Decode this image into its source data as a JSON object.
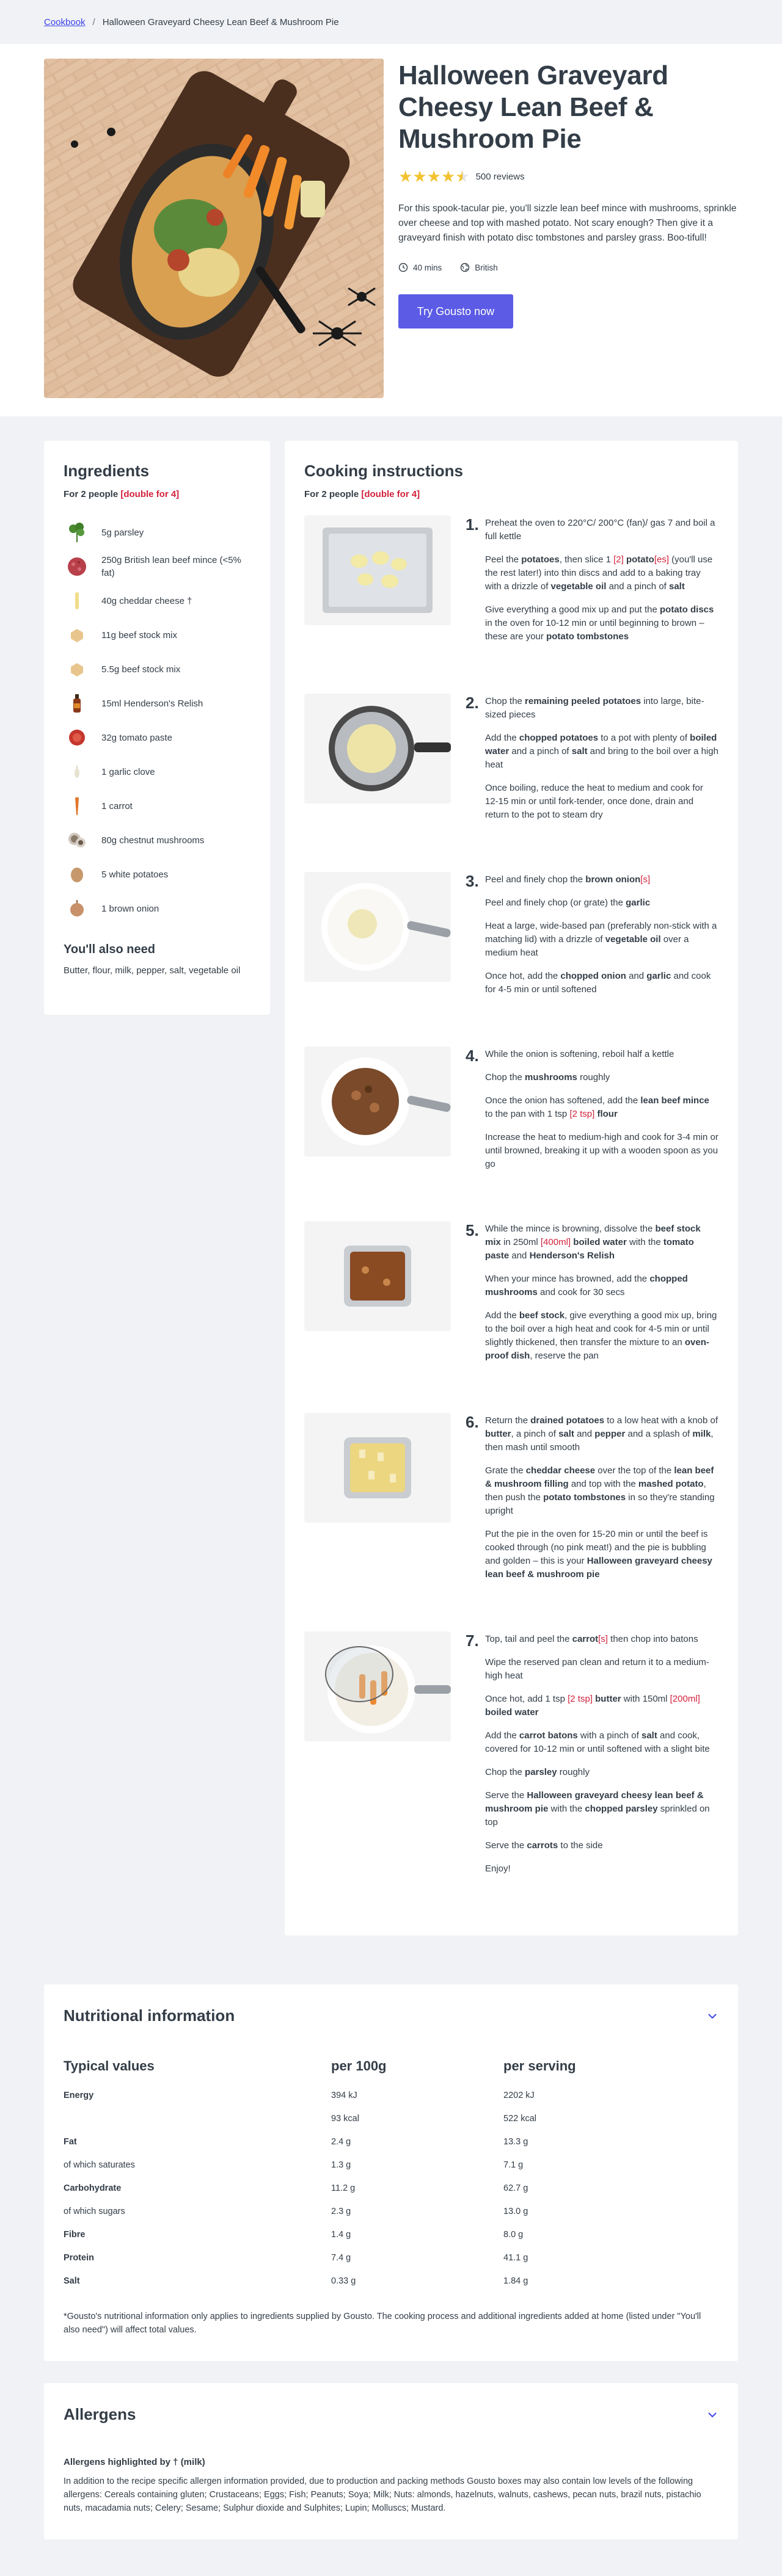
{
  "breadcrumb": {
    "root": "Cookbook",
    "separator": "/",
    "current": "Halloween Graveyard Cheesy Lean Beef & Mushroom Pie"
  },
  "recipe": {
    "title": "Halloween Graveyard Cheesy Lean Beef & Mushroom Pie",
    "rating_value": 4.5,
    "reviews": "500 reviews",
    "description": "For this spook-tacular pie, you'll sizzle lean beef mince with mushrooms, sprinkle over cheese and top with mashed potato. Not scary enough? Then give it a graveyard finish with potato disc tombstones and parsley grass. Boo-tifull!",
    "time": "40 mins",
    "cuisine": "British",
    "time_icon": "clock-icon",
    "cuisine_icon": "globe-icon",
    "cta": "Try Gousto now"
  },
  "ingredients": {
    "title": "Ingredients",
    "servings_text": "For 2 people",
    "double_text": "[double for 4]",
    "items": [
      {
        "label": "5g parsley",
        "icon": "parsley"
      },
      {
        "label": "250g British lean beef mince (<5% fat)",
        "icon": "beef-mince"
      },
      {
        "label": "40g cheddar cheese †",
        "icon": "cheddar"
      },
      {
        "label": "11g beef stock mix",
        "icon": "stock-mix"
      },
      {
        "label": "5.5g beef stock mix",
        "icon": "stock-mix"
      },
      {
        "label": "15ml Henderson's Relish",
        "icon": "relish-bottle"
      },
      {
        "label": "32g tomato paste",
        "icon": "tomato-paste"
      },
      {
        "label": "1 garlic clove",
        "icon": "garlic"
      },
      {
        "label": "1 carrot",
        "icon": "carrot"
      },
      {
        "label": "80g chestnut mushrooms",
        "icon": "mushrooms"
      },
      {
        "label": "5 white potatoes",
        "icon": "potato"
      },
      {
        "label": "1 brown onion",
        "icon": "onion"
      }
    ],
    "also_title": "You'll also need",
    "also_text": "Butter, flour, milk, pepper, salt, vegetable oil"
  },
  "instructions": {
    "title": "Cooking instructions",
    "servings_text": "For 2 people",
    "double_text": "[double for 4]",
    "steps": [
      {
        "num": "1.",
        "image": "potato-discs-on-tray",
        "paras": [
          [
            {
              "t": "Preheat the oven to 220°C/ 200°C (fan)/ gas 7 and boil a full kettle"
            }
          ],
          [
            {
              "t": "Peel the "
            },
            {
              "t": "potatoes",
              "b": true
            },
            {
              "t": ", then slice 1 "
            },
            {
              "t": "[2]",
              "h": true
            },
            {
              "t": " "
            },
            {
              "t": "potato",
              "b": true
            },
            {
              "t": "[es]",
              "h": true
            },
            {
              "t": " (you'll use the rest later!) into thin discs and add to a baking tray with a drizzle of "
            },
            {
              "t": "vegetable oil",
              "b": true
            },
            {
              "t": " and a pinch of "
            },
            {
              "t": "salt",
              "b": true
            }
          ],
          [
            {
              "t": "Give everything a good mix up and put the "
            },
            {
              "t": "potato discs",
              "b": true
            },
            {
              "t": " in the oven for 10-12 min or until beginning to brown – these are your "
            },
            {
              "t": "potato tombstones",
              "b": true
            }
          ]
        ]
      },
      {
        "num": "2.",
        "image": "potatoes-in-pan",
        "paras": [
          [
            {
              "t": "Chop the "
            },
            {
              "t": "remaining peeled potatoes",
              "b": true
            },
            {
              "t": " into large, bite-sized pieces"
            }
          ],
          [
            {
              "t": "Add the "
            },
            {
              "t": "chopped potatoes",
              "b": true
            },
            {
              "t": " to a pot with plenty of "
            },
            {
              "t": "boiled water",
              "b": true
            },
            {
              "t": " and a pinch of "
            },
            {
              "t": "salt",
              "b": true
            },
            {
              "t": " and bring to the boil over a high heat"
            }
          ],
          [
            {
              "t": "Once boiling, reduce the heat to medium and cook for 12-15 min or until fork-tender, once done, drain and return to the pot to steam dry"
            }
          ]
        ]
      },
      {
        "num": "3.",
        "image": "onion-in-pan",
        "paras": [
          [
            {
              "t": "Peel and finely chop the "
            },
            {
              "t": "brown onion",
              "b": true
            },
            {
              "t": "[s]",
              "h": true
            }
          ],
          [
            {
              "t": "Peel and finely chop (or grate) the "
            },
            {
              "t": "garlic",
              "b": true
            }
          ],
          [
            {
              "t": "Heat a large, wide-based pan (preferably non-stick with a matching lid) with a drizzle of "
            },
            {
              "t": "vegetable oil",
              "b": true
            },
            {
              "t": " over a medium heat"
            }
          ],
          [
            {
              "t": "Once hot, add the "
            },
            {
              "t": "chopped onion",
              "b": true
            },
            {
              "t": " and "
            },
            {
              "t": "garlic",
              "b": true
            },
            {
              "t": " and cook for 4-5 min or until softened"
            }
          ]
        ]
      },
      {
        "num": "4.",
        "image": "mince-in-pan",
        "paras": [
          [
            {
              "t": "While the onion is softening, reboil half a kettle"
            }
          ],
          [
            {
              "t": "Chop the "
            },
            {
              "t": "mushrooms",
              "b": true
            },
            {
              "t": " roughly"
            }
          ],
          [
            {
              "t": "Once the onion has softened, add the "
            },
            {
              "t": "lean beef mince",
              "b": true
            },
            {
              "t": " to the pan with 1 tsp "
            },
            {
              "t": "[2 tsp]",
              "h": true
            },
            {
              "t": " "
            },
            {
              "t": "flour",
              "b": true
            }
          ],
          [
            {
              "t": "Increase the heat to medium-high and cook for 3-4 min or until browned, breaking it up with a wooden spoon as you go"
            }
          ]
        ]
      },
      {
        "num": "5.",
        "image": "filling-in-dish",
        "paras": [
          [
            {
              "t": "While the mince is browning, dissolve the "
            },
            {
              "t": "beef stock mix",
              "b": true
            },
            {
              "t": " in 250ml "
            },
            {
              "t": "[400ml]",
              "h": true
            },
            {
              "t": " "
            },
            {
              "t": "boiled water",
              "b": true
            },
            {
              "t": " with the "
            },
            {
              "t": "tomato paste",
              "b": true
            },
            {
              "t": " and "
            },
            {
              "t": "Henderson's Relish",
              "b": true
            }
          ],
          [
            {
              "t": "When your mince has browned, add the "
            },
            {
              "t": "chopped mushrooms",
              "b": true
            },
            {
              "t": " and cook for 30 secs"
            }
          ],
          [
            {
              "t": "Add the "
            },
            {
              "t": "beef stock",
              "b": true
            },
            {
              "t": ", give everything a good mix up, bring to the boil over a high heat and cook for 4-5 min or until slightly thickened, then transfer the mixture to an "
            },
            {
              "t": "oven-proof dish",
              "b": true
            },
            {
              "t": ", reserve the pan"
            }
          ]
        ]
      },
      {
        "num": "6.",
        "image": "pie-in-dish",
        "paras": [
          [
            {
              "t": "Return the "
            },
            {
              "t": "drained potatoes",
              "b": true
            },
            {
              "t": " to a low heat with a knob of "
            },
            {
              "t": "butter",
              "b": true
            },
            {
              "t": ", a pinch of "
            },
            {
              "t": "salt",
              "b": true
            },
            {
              "t": " and "
            },
            {
              "t": "pepper",
              "b": true
            },
            {
              "t": " and a splash of "
            },
            {
              "t": "milk",
              "b": true
            },
            {
              "t": ", then mash until smooth"
            }
          ],
          [
            {
              "t": "Grate the "
            },
            {
              "t": "cheddar cheese",
              "b": true
            },
            {
              "t": " over the top of the "
            },
            {
              "t": "lean beef & mushroom filling",
              "b": true
            },
            {
              "t": " and top with the "
            },
            {
              "t": "mashed potato",
              "b": true
            },
            {
              "t": ", then push the "
            },
            {
              "t": "potato tombstones",
              "b": true
            },
            {
              "t": " in so they're standing upright"
            }
          ],
          [
            {
              "t": "Put the pie in the oven for 15-20 min or until the beef is cooked through (no pink meat!) and the pie is bubbling and golden – this is your "
            },
            {
              "t": "Halloween graveyard cheesy lean beef & mushroom pie",
              "b": true
            }
          ]
        ]
      },
      {
        "num": "7.",
        "image": "carrots-in-pan",
        "paras": [
          [
            {
              "t": "Top, tail and peel the "
            },
            {
              "t": "carrot",
              "b": true
            },
            {
              "t": "[s]",
              "h": true
            },
            {
              "t": " then chop into batons"
            }
          ],
          [
            {
              "t": "Wipe the reserved pan clean and return it to a medium-high heat"
            }
          ],
          [
            {
              "t": "Once hot, add 1 tsp "
            },
            {
              "t": "[2 tsp]",
              "h": true
            },
            {
              "t": " "
            },
            {
              "t": "butter",
              "b": true
            },
            {
              "t": " with 150ml "
            },
            {
              "t": "[200ml]",
              "h": true
            },
            {
              "t": " "
            },
            {
              "t": "boiled water",
              "b": true
            }
          ],
          [
            {
              "t": "Add the "
            },
            {
              "t": "carrot batons",
              "b": true
            },
            {
              "t": " with a pinch of "
            },
            {
              "t": "salt",
              "b": true
            },
            {
              "t": " and cook, covered for 10-12 min or until softened with a slight bite"
            }
          ],
          [
            {
              "t": "Chop the "
            },
            {
              "t": "parsley",
              "b": true
            },
            {
              "t": " roughly"
            }
          ],
          [
            {
              "t": "Serve the "
            },
            {
              "t": "Halloween graveyard cheesy lean beef & mushroom pie",
              "b": true
            },
            {
              "t": " with the "
            },
            {
              "t": "chopped parsley",
              "b": true
            },
            {
              "t": " sprinkled on top"
            }
          ],
          [
            {
              "t": "Serve the "
            },
            {
              "t": "carrots",
              "b": true
            },
            {
              "t": " to the side"
            }
          ],
          [
            {
              "t": "Enjoy!"
            }
          ]
        ]
      }
    ]
  },
  "nutrition": {
    "title": "Nutritional information",
    "toggle_icon": "chevron-down-icon",
    "headers": [
      "Typical values",
      "per 100g",
      "per serving"
    ],
    "rows": [
      {
        "label": "Energy",
        "per100": "394 kJ",
        "serving": "2202 kJ",
        "bold": true
      },
      {
        "label": "",
        "per100": "93 kcal",
        "serving": "522 kcal",
        "bold": false
      },
      {
        "label": "Fat",
        "per100": "2.4 g",
        "serving": "13.3 g",
        "bold": true
      },
      {
        "label": "of which saturates",
        "per100": "1.3 g",
        "serving": "7.1 g",
        "bold": false
      },
      {
        "label": "Carbohydrate",
        "per100": "11.2 g",
        "serving": "62.7 g",
        "bold": true
      },
      {
        "label": "of which sugars",
        "per100": "2.3 g",
        "serving": "13.0 g",
        "bold": false
      },
      {
        "label": "Fibre",
        "per100": "1.4 g",
        "serving": "8.0 g",
        "bold": true
      },
      {
        "label": "Protein",
        "per100": "7.4 g",
        "serving": "41.1 g",
        "bold": true
      },
      {
        "label": "Salt",
        "per100": "0.33 g",
        "serving": "1.84 g",
        "bold": true
      }
    ],
    "note": "*Gousto's nutritional information only applies to ingredients supplied by Gousto. The cooking process and additional ingredients added at home (listed under \"You'll also need\") will affect total values."
  },
  "allergens": {
    "title": "Allergens",
    "toggle_icon": "chevron-down-icon",
    "subtitle": "Allergens highlighted by † (milk)",
    "text": "In addition to the recipe specific allergen information provided, due to production and packing methods Gousto boxes may also contain low levels of the following allergens: Cereals containing gluten; Crustaceans; Eggs; Fish; Peanuts; Soya; Milk; Nuts: almonds, hazelnuts, walnuts, cashews, pecan nuts, brazil nuts, pistachio nuts, macadamia nuts; Celery; Sesame; Sulphur dioxide and Sulphites; Lupin; Molluscs; Mustard."
  },
  "colors": {
    "accent": "#5b5be6",
    "link": "#3c43e8",
    "highlight": "#d2223d",
    "star": "#f2c230",
    "text": "#333d47",
    "background": "#f0f2f5"
  }
}
